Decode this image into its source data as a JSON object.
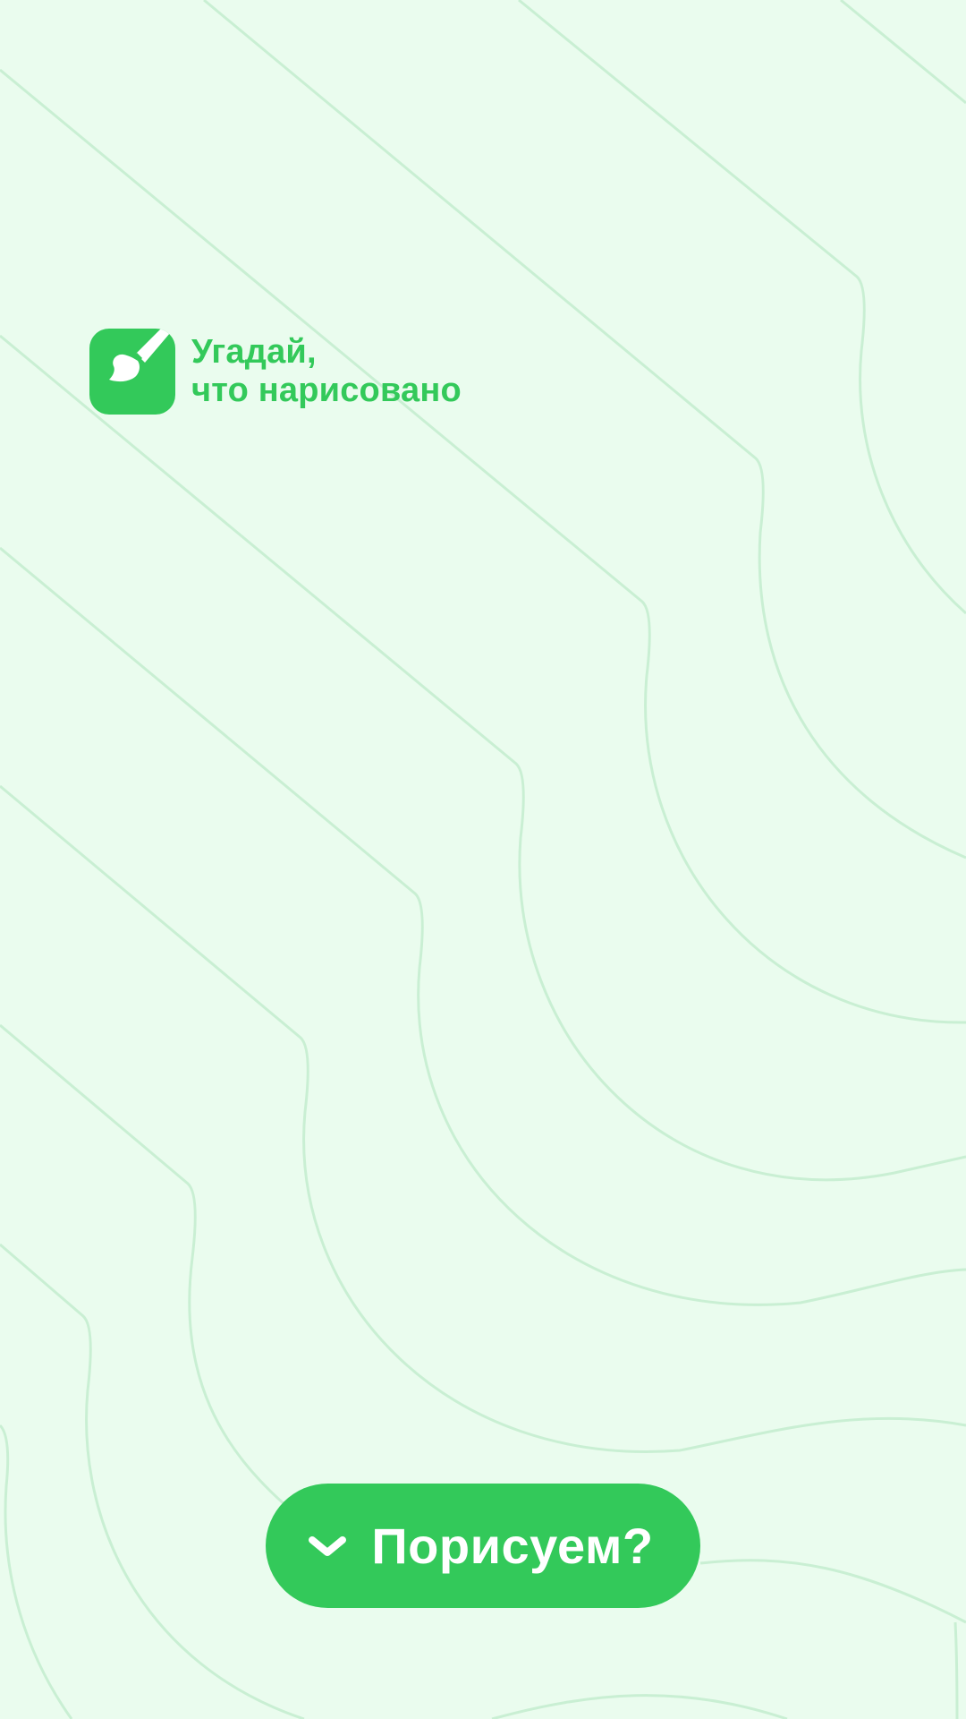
{
  "app": {
    "logo_icon": "paintbrush-icon",
    "title_line1": "Угадай,",
    "title_line2": "что нарисовано"
  },
  "cta": {
    "icon": "chevron-down-icon",
    "label": "Порисуем?"
  },
  "colors": {
    "background": "#eafcee",
    "accent": "#33c95a",
    "pattern_lines": "#c9efd3",
    "on_accent": "#ffffff"
  }
}
